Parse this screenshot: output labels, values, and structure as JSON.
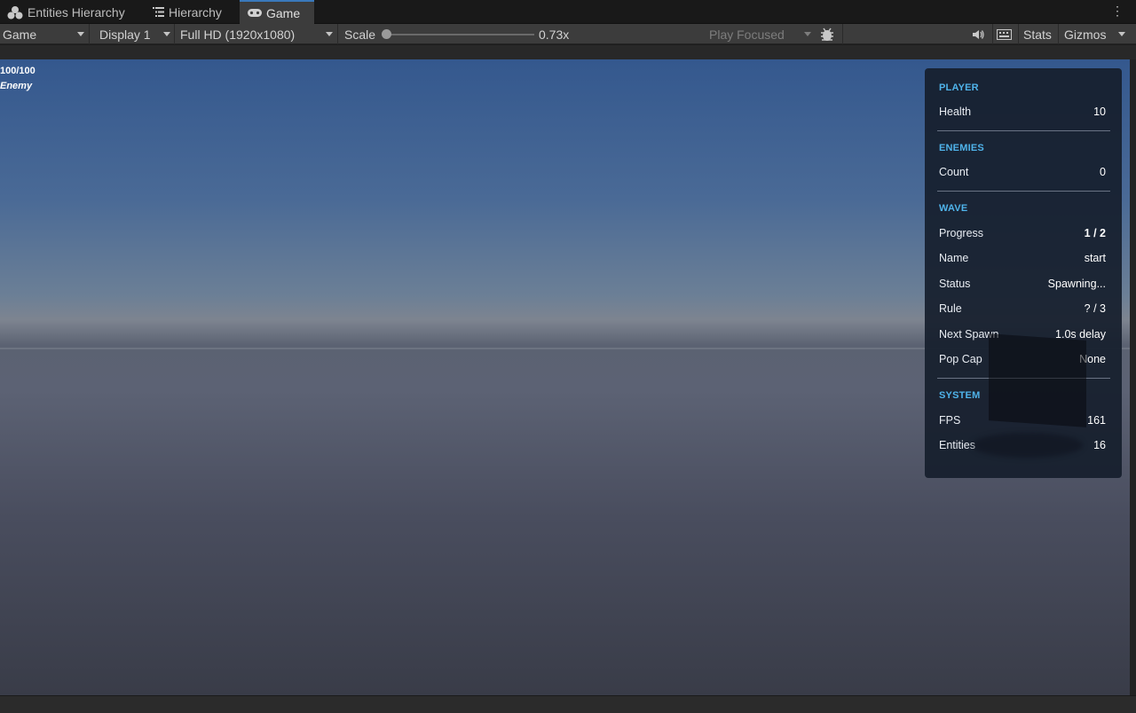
{
  "tabs": [
    {
      "label": "Entities Hierarchy",
      "icon": "entities-icon"
    },
    {
      "label": "Hierarchy",
      "icon": "hierarchy-list-icon"
    },
    {
      "label": "Game",
      "icon": "gamepad-icon",
      "active": true
    }
  ],
  "toolbar": {
    "mode": "Game",
    "display": "Display 1",
    "resolution": "Full HD (1920x1080)",
    "scale_label": "Scale",
    "scale_value": "0.73x",
    "play_focused": "Play Focused",
    "stats": "Stats",
    "gizmos": "Gizmos"
  },
  "scene": {
    "enemy_health": "100/100",
    "enemy_label": "Enemy"
  },
  "hud": {
    "player": {
      "title": "PLAYER",
      "health_label": "Health",
      "health_value": "10"
    },
    "enemies": {
      "title": "ENEMIES",
      "count_label": "Count",
      "count_value": "0"
    },
    "wave": {
      "title": "WAVE",
      "rows": [
        {
          "label": "Progress",
          "value": "1 / 2"
        },
        {
          "label": "Name",
          "value": "start"
        },
        {
          "label": "Status",
          "value": "Spawning..."
        },
        {
          "label": "Rule",
          "value": "? / 3"
        },
        {
          "label": "Next Spawn",
          "value": "1.0s delay"
        },
        {
          "label": "Pop Cap",
          "value": "None"
        }
      ]
    },
    "system": {
      "title": "SYSTEM",
      "fps_label": "FPS",
      "fps_value": "161",
      "entities_label": "Entities",
      "entities_value": "16"
    }
  },
  "colors": {
    "accent": "#4fb3ea",
    "active_tab": "#3a79bb"
  }
}
